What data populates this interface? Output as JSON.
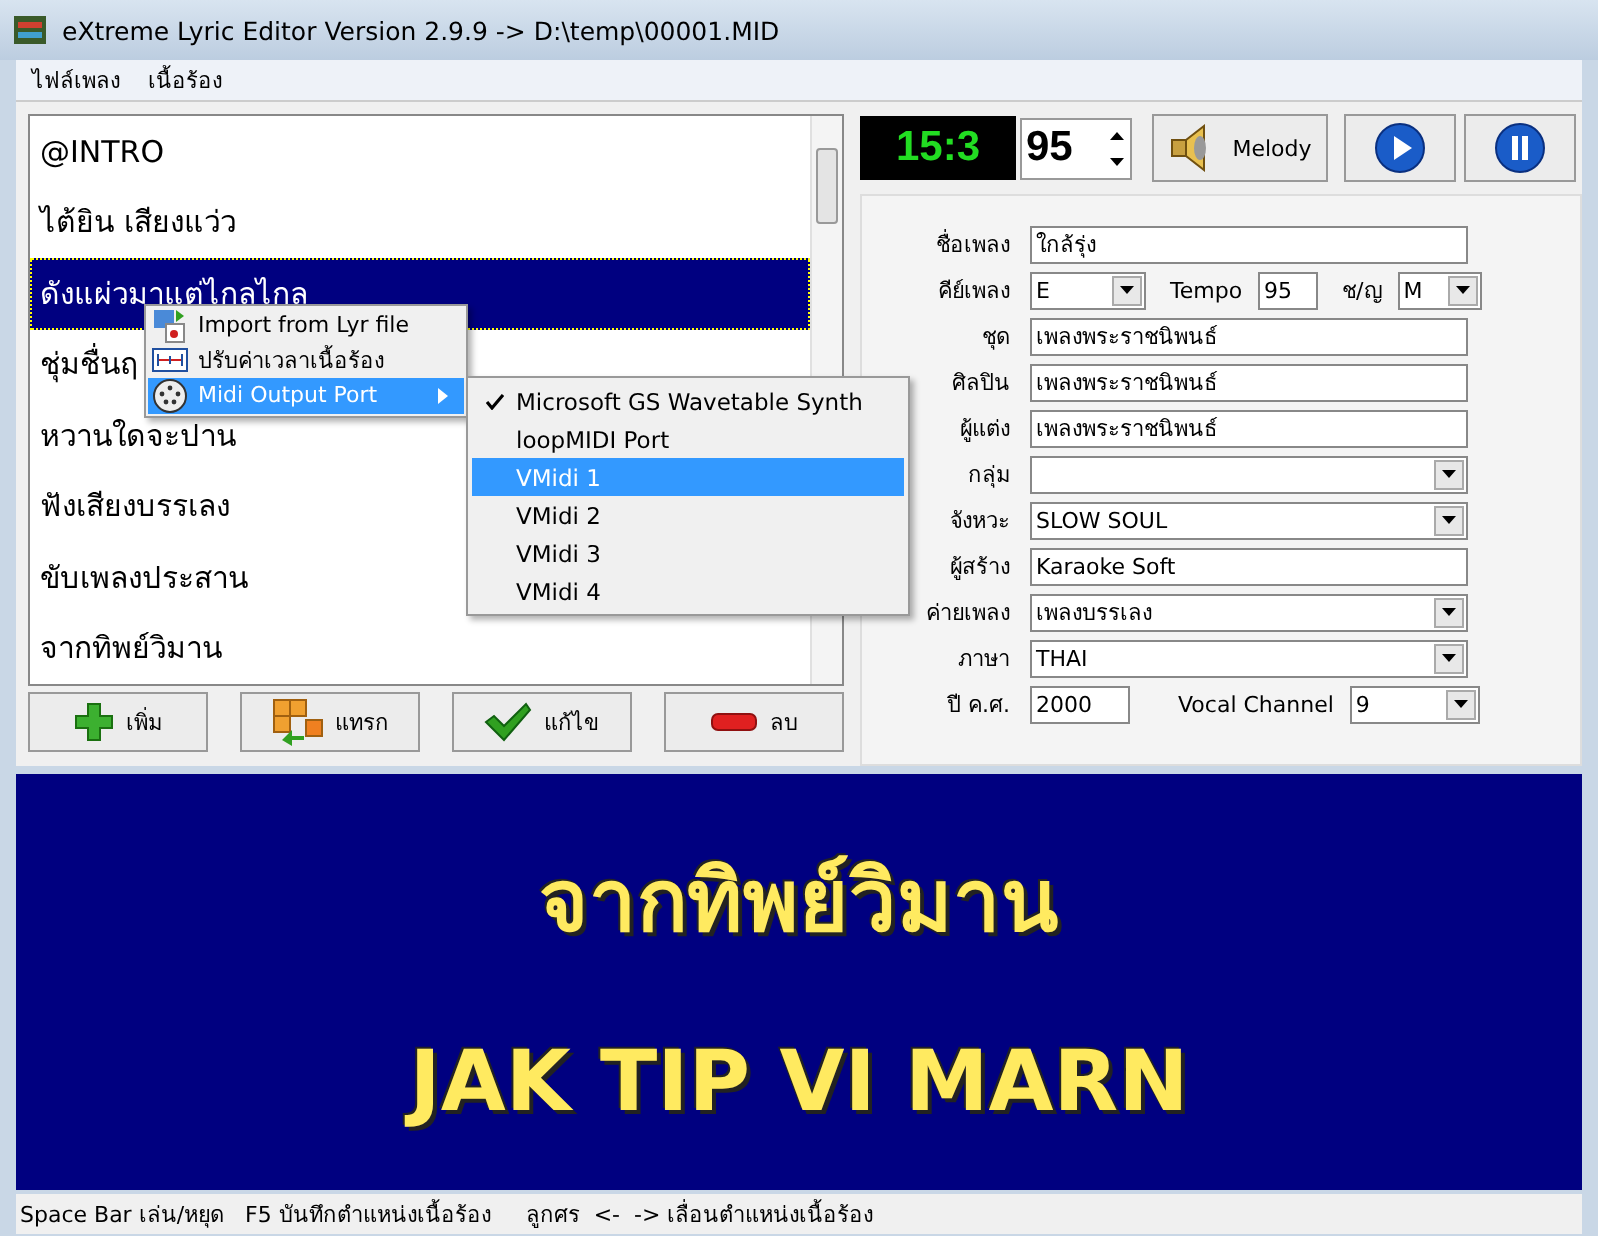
{
  "window": {
    "title": "eXtreme Lyric Editor Version 2.9.9   -> D:\\temp\\00001.MID"
  },
  "menu_bar": [
    "ไฟล์เพลง",
    "เนื้อร้อง"
  ],
  "lyrics": [
    {
      "text": "@INTRO",
      "selected": false
    },
    {
      "text": "ไต้ยิน เสียงแว่ว",
      "selected": false
    },
    {
      "text": "ดังแผ่วมาแต่ไกลไกล",
      "selected": true
    },
    {
      "text": "ชุ่มชื่นฤ",
      "selected": false
    },
    {
      "text": "หวานใดจะปาน",
      "selected": false
    },
    {
      "text": "ฟังเสียงบรรเลง",
      "selected": false
    },
    {
      "text": "ขับเพลงประสาน",
      "selected": false
    },
    {
      "text": "จากทิพย์วิมาน",
      "selected": false
    }
  ],
  "list_buttons": [
    {
      "label": "เพิ่ม",
      "kind": "add"
    },
    {
      "label": "แทรก",
      "kind": "insert"
    },
    {
      "label": "แก้ไข",
      "kind": "edit"
    },
    {
      "label": "ลบ",
      "kind": "delete"
    }
  ],
  "context_menu": {
    "items": [
      {
        "label": "Import from Lyr file",
        "kind": "import",
        "selected": false
      },
      {
        "label": "ปรับค่าเวลาเนื้อร้อง",
        "kind": "timing",
        "selected": false
      },
      {
        "label": "Midi Output Port",
        "kind": "port",
        "selected": true
      }
    ],
    "submenu": [
      {
        "label": "Microsoft GS Wavetable Synth",
        "checked": true,
        "selected": false
      },
      {
        "label": "loopMIDI Port",
        "checked": false,
        "selected": false
      },
      {
        "label": "VMidi 1",
        "checked": false,
        "selected": true
      },
      {
        "label": "VMidi 2",
        "checked": false,
        "selected": false
      },
      {
        "label": "VMidi 3",
        "checked": false,
        "selected": false
      },
      {
        "label": "VMidi 4",
        "checked": false,
        "selected": false
      }
    ]
  },
  "transport": {
    "time": "15:3",
    "tempo": "95",
    "melody_label": "Melody"
  },
  "song_info": [
    {
      "label": "ชื่อเพลง",
      "value": "ใกล้รุ่ง",
      "kind": "text"
    },
    {
      "label": "คีย์เพลง",
      "kind": "key",
      "key": "E",
      "tempo_label": "Tempo",
      "tempo": "95",
      "gender_label": "ช/ญ",
      "gender": "M"
    },
    {
      "label": "ชุด",
      "value": "เพลงพระราชนิพนธ์",
      "kind": "text"
    },
    {
      "label": "ศิลปิน",
      "value": "เพลงพระราชนิพนธ์",
      "kind": "text"
    },
    {
      "label": "ผู้แต่ง",
      "value": "เพลงพระราชนิพนธ์",
      "kind": "text"
    },
    {
      "label": "กลุ่ม",
      "kind": "select"
    },
    {
      "label": "จังหวะ",
      "value": "SLOW SOUL",
      "kind": "select"
    },
    {
      "label": "ผู้สร้าง",
      "value": "Karaoke Soft",
      "kind": "text"
    },
    {
      "label": "ค่ายเพลง",
      "value": "เพลงบรรเลง",
      "kind": "select"
    },
    {
      "label": "ภาษา",
      "value": "THAI",
      "kind": "select"
    },
    {
      "label": "ปี ค.ศ.",
      "kind": "year",
      "value": "2000",
      "channel_label": "Vocal Channel",
      "channel": "9"
    }
  ],
  "display": {
    "lyric": "จากทิพย์วิมาน",
    "transliteration": "JAK TIP VI MARN"
  },
  "status_bar": "Space Bar เล่น/หยุด   F5 บันทึกตำแหน่งเนื้อร้อง     ลูกศร  <-  -> เลื่อนตำแหน่งเนื้อร้อง"
}
